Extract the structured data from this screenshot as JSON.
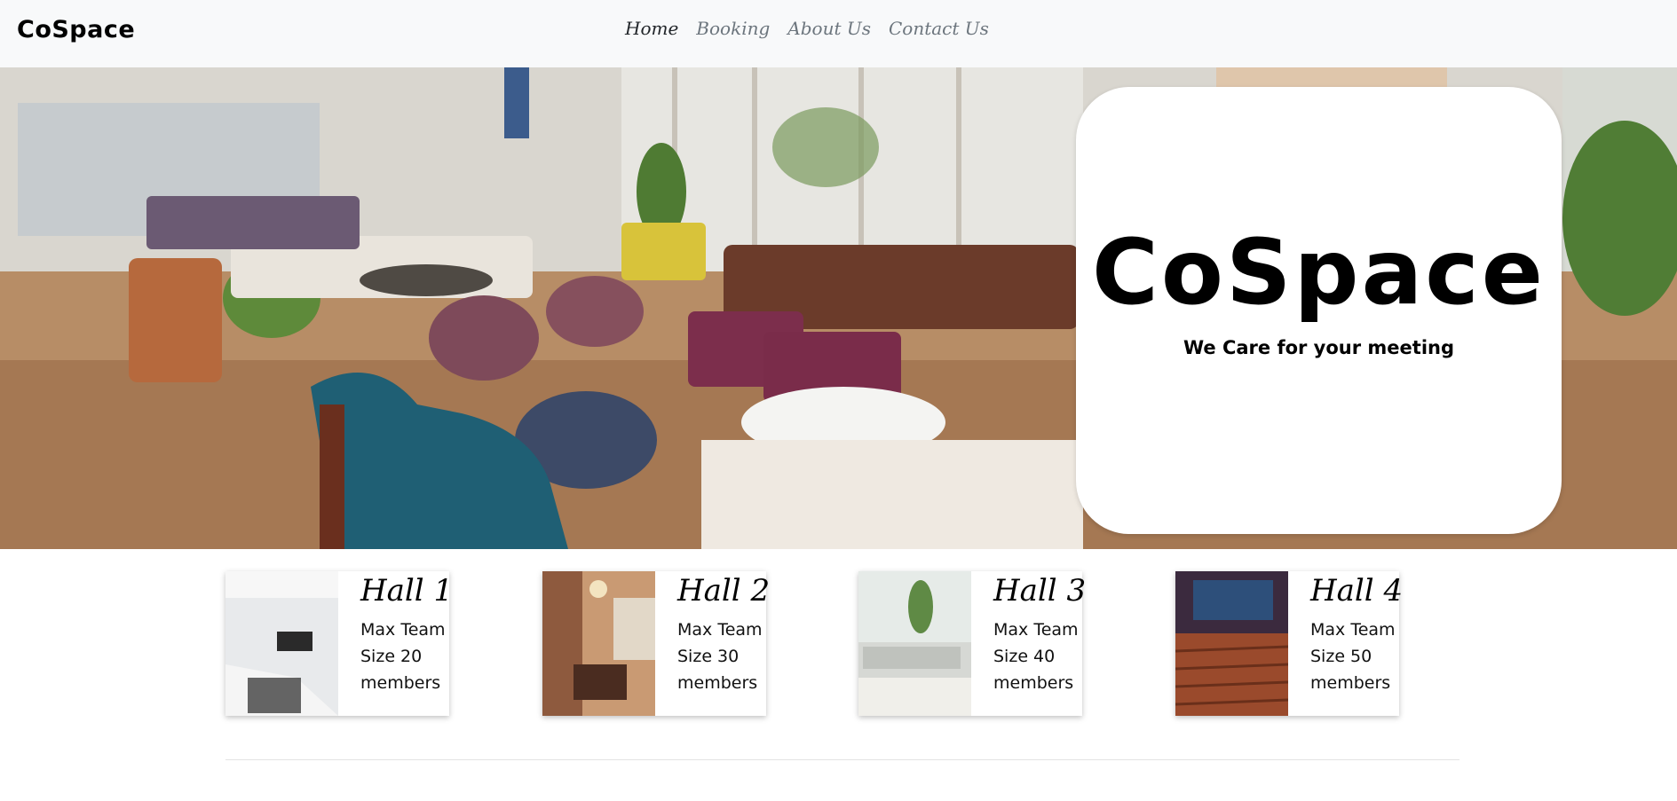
{
  "navbar": {
    "brand": "CoSpace",
    "links": [
      {
        "label": "Home",
        "active": true
      },
      {
        "label": "Booking",
        "active": false
      },
      {
        "label": "About Us",
        "active": false
      },
      {
        "label": "Contact Us",
        "active": false
      }
    ]
  },
  "hero": {
    "image": "coworking-lounge-photo",
    "logo_title": "CoSpace",
    "logo_tagline": "We Care for your meeting"
  },
  "halls": [
    {
      "title": "Hall 1",
      "text": "Max Team Size 20 members",
      "image": "office-meeting-room-photo"
    },
    {
      "title": "Hall 2",
      "text": "Max Team Size 30 members",
      "image": "dining-conference-room-photo"
    },
    {
      "title": "Hall 3",
      "text": "Max Team Size 40 members",
      "image": "bright-workspace-photo"
    },
    {
      "title": "Hall 4",
      "text": "Max Team Size 50 members",
      "image": "theater-auditorium-photo"
    }
  ]
}
